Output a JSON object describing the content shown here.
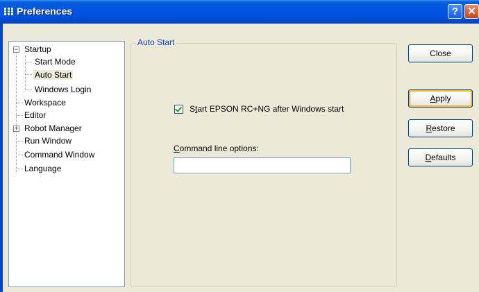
{
  "window": {
    "title": "Preferences",
    "help_glyph": "?",
    "close_glyph": "✕",
    "icon": "app-grid-icon"
  },
  "tree": {
    "items": [
      {
        "label": "Startup",
        "expander": "−"
      },
      {
        "label": "Start Mode"
      },
      {
        "label": "Auto Start",
        "selected": true
      },
      {
        "label": "Windows Login"
      },
      {
        "label": "Workspace"
      },
      {
        "label": "Editor"
      },
      {
        "label": "Robot Manager",
        "expander": "+"
      },
      {
        "label": "Run Window"
      },
      {
        "label": "Command Window"
      },
      {
        "label": "Language"
      }
    ]
  },
  "panel": {
    "group_title": "Auto Start",
    "checkbox": {
      "checked": true,
      "label_pre": "S",
      "label_accel": "t",
      "label_post": "art EPSON RC+NG after Windows start"
    },
    "options": {
      "label_accel": "C",
      "label_rest": "ommand line options:",
      "value": "",
      "placeholder": ""
    }
  },
  "buttons": {
    "close": "Close",
    "apply_accel": "A",
    "apply_rest": "pply",
    "restore_accel": "R",
    "restore_rest": "estore",
    "defaults_accel": "D",
    "defaults_rest": "efaults"
  },
  "colors": {
    "titlebar": "#0055e5",
    "face": "#ece9d8",
    "group_title": "#0046d5",
    "check": "#21a121",
    "default_button_ring": "#f8b330"
  }
}
